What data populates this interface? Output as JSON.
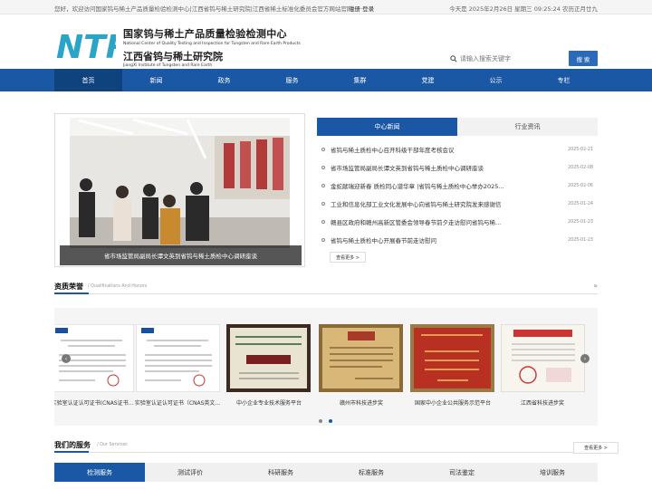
{
  "topbar": {
    "welcome": "您好，欢迎访问国家钨与稀土产品质量检验检测中心|江西省钨与稀土研究院|江西省稀土标准化委员会官方网站官网!",
    "register": "注册",
    "login": "登录",
    "separator": "·",
    "date": "今天是 2025年2月26日 星期三 09:25:24 农历正月廿九"
  },
  "header": {
    "logo_letters": "NTR",
    "name_cn_1": "国家钨与稀土产品质量检验检测中心",
    "name_en_1": "National Center of Quality Testing and Inspection for Tungsten and Rare Earth Products",
    "name_cn_2": "江西省钨与稀土研究院",
    "name_en_2": "JiangXi Institute of Tungsten and Rare Earth",
    "search_placeholder": "请输入搜索关键字",
    "search_button": "搜 索",
    "brand_color": "#1a58a5",
    "logo_color": "#2aa5c8"
  },
  "nav": {
    "items": [
      "首页",
      "新闻",
      "政务",
      "服务",
      "集群",
      "党建",
      "公示",
      "专栏"
    ],
    "active_index": 0
  },
  "hero": {
    "caption": "省市场监管局副局长谭文英到省钨与稀土质检中心调研座谈"
  },
  "news": {
    "tabs": [
      "中心新闻",
      "行业资讯"
    ],
    "active_tab": 0,
    "items": [
      {
        "title": "省钨与稀土质检中心召开科级干部年度考核会议",
        "date": "2025-02-21"
      },
      {
        "title": "省市场监管局副局长谭文英到省钨与稀土质检中心调研座谈",
        "date": "2025-02-08"
      },
      {
        "title": "金蛇献瑞迎新春 质检同心谱华章 |省钨与稀土质检中心举办2025...",
        "date": "2025-02-06"
      },
      {
        "title": "工业和信息化部工业文化发展中心向省钨与稀土研究院发来感谢信",
        "date": "2025-01-24"
      },
      {
        "title": "赣县区政府和赣州高新区管委会领导春节前夕走访慰问省钨与稀...",
        "date": "2025-01-23"
      },
      {
        "title": "省钨与稀土质检中心开展春节前走访慰问",
        "date": "2025-01-23"
      }
    ],
    "more": "查看更多 >"
  },
  "honors": {
    "title": "资质荣誉",
    "subtitle": "/ Qualifications And Honors",
    "arrow": "»",
    "certs": [
      {
        "label": "实验室认证认可证书(CNAS证书...",
        "style": "doc"
      },
      {
        "label": "实验室认证认可证书（CNAS英文...",
        "style": "doc"
      },
      {
        "label": "中小企业专业技术服务平台",
        "style": "plaque-green"
      },
      {
        "label": "赣州市科技进步奖",
        "style": "plaque-gold"
      },
      {
        "label": "国家中小企业公共服务示范平台",
        "style": "plaque-red"
      },
      {
        "label": "江西省科技进步奖",
        "style": "cert-red"
      }
    ],
    "prev": "‹",
    "next": "›",
    "dot_count": 2,
    "active_dot": 1
  },
  "services": {
    "title": "我们的服务",
    "subtitle": "/ Our Services",
    "more": "查看更多 >",
    "tabs": [
      "检测服务",
      "测试评价",
      "科研服务",
      "标准服务",
      "司法鉴定",
      "培训服务"
    ],
    "active_tab": 0
  }
}
